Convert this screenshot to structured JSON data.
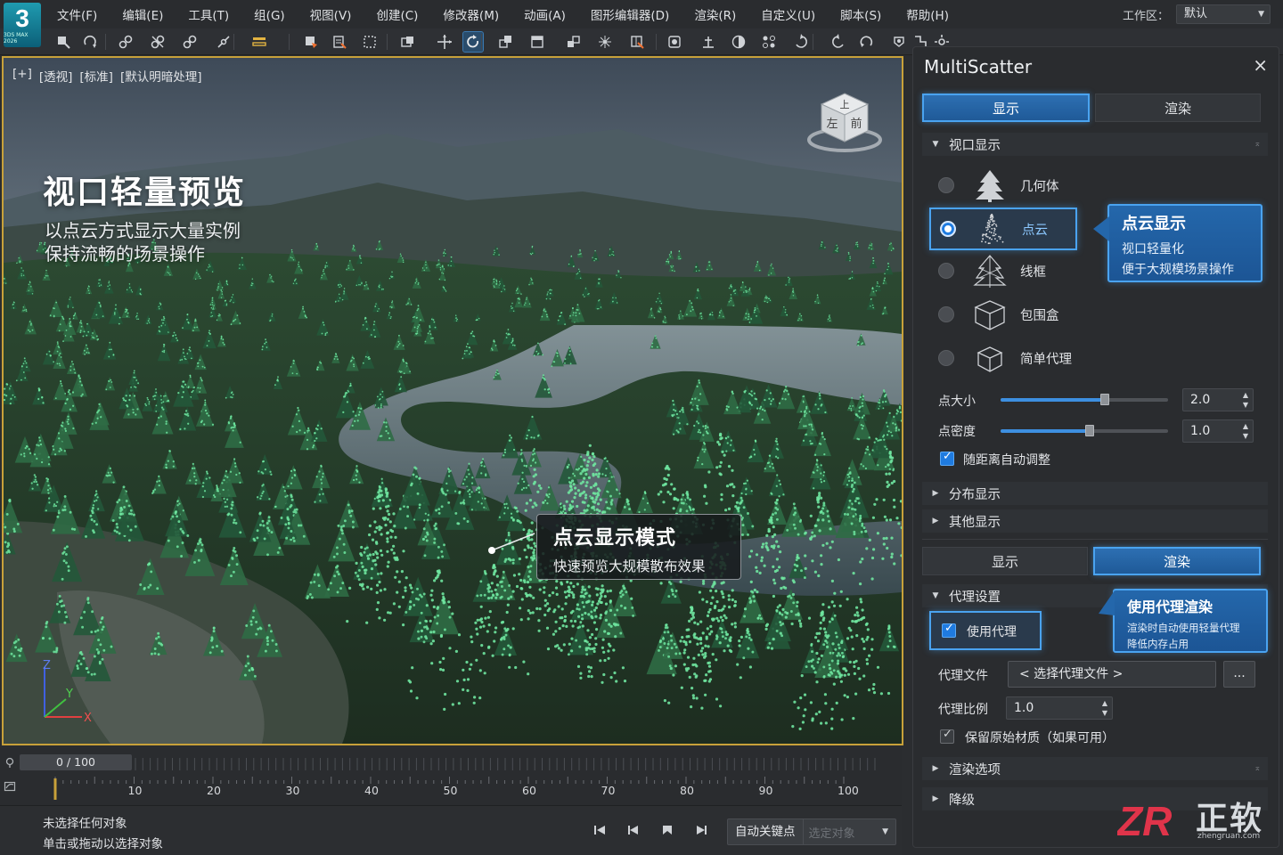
{
  "app": {
    "logo_number": "3",
    "logo_sub": "3DS MAX 2026"
  },
  "menubar": {
    "items": [
      "文件(F)",
      "编辑(E)",
      "工具(T)",
      "组(G)",
      "视图(V)",
      "创建(C)",
      "修改器(M)",
      "动画(A)",
      "图形编辑器(D)",
      "渲染(R)",
      "自定义(U)",
      "脚本(S)",
      "帮助(H)"
    ],
    "workspace_label": "工作区：",
    "workspace_value": "默认"
  },
  "toolbar": {
    "icons": [
      "select-icon",
      "redo-icon",
      "link-icon",
      "unlink-icon",
      "bind-icon",
      "unbind-icon",
      "selection-filter-icon",
      "select-object-icon",
      "select-by-name-icon",
      "rect-region-icon",
      "window-crossing-icon",
      "move-icon",
      "rotate-icon",
      "scale-icon",
      "ref-coord-icon",
      "pivot-icon",
      "snap-icon",
      "mirror-icon",
      "align-icon",
      "layers-icon",
      "scene-explorer-icon",
      "material-icon",
      "render-setup-icon",
      "render-frame-icon",
      "undo-icon",
      "redo2-icon",
      "viewport-icon",
      "settings-icon"
    ],
    "active_icon": "rotate-icon"
  },
  "viewport": {
    "labels": [
      "[+]",
      "[透视]",
      "[标准]",
      "[默认明暗处理]"
    ],
    "title": "视口轻量预览",
    "subtitle_1": "以点云方式显示大量实例",
    "subtitle_2": "保持流畅的场景操作",
    "viewcube": {
      "top": "上",
      "left": "左",
      "front": "前"
    },
    "callout_title": "点云显示模式",
    "callout_sub": "快速预览大规模散布效果",
    "axes": {
      "x": "X",
      "y": "Y",
      "z": "Z"
    },
    "colors": {
      "border": "#c8a13a",
      "points": "#6fe6a0"
    }
  },
  "timeline": {
    "frame_display": "0 / 100",
    "ruler_labels": [
      "10",
      "20",
      "30",
      "40",
      "50",
      "60",
      "70",
      "80",
      "90",
      "100"
    ]
  },
  "statusbar": {
    "line1": "未选择任何对象",
    "line2": "单击或拖动以选择对象",
    "autokey_label": "自动关键点",
    "autokey_value": "选定对象"
  },
  "panel": {
    "title": "MultiScatter",
    "close": "×",
    "tabs_top": [
      "显示",
      "渲染"
    ],
    "tabs_top_active": 0,
    "section_viewport": "视口显示",
    "display_modes": [
      {
        "label": "几何体",
        "icon": "tree-solid-icon",
        "selected": false
      },
      {
        "label": "点云",
        "icon": "tree-points-icon",
        "selected": true
      },
      {
        "label": "线框",
        "icon": "tree-wire-icon",
        "selected": false
      },
      {
        "label": "包围盒",
        "icon": "bounding-box-icon",
        "selected": false
      },
      {
        "label": "简单代理",
        "icon": "simple-proxy-icon",
        "selected": false
      }
    ],
    "callout_points_title": "点云显示",
    "callout_points_line1": "视口轻量化",
    "callout_points_line2": "便于大规模场景操作",
    "point_size_label": "点大小",
    "point_size_value": "2.0",
    "point_size_level": 0.62,
    "point_density_label": "点密度",
    "point_density_value": "1.0",
    "point_density_level": 0.53,
    "auto_adjust_label": "随距离自动调整",
    "auto_adjust_checked": true,
    "section_distribution": "分布显示",
    "section_other": "其他显示",
    "tabs_bottom": [
      "显示",
      "渲染"
    ],
    "tabs_bottom_active": 1,
    "section_proxy": "代理设置",
    "use_proxy_label": "使用代理",
    "use_proxy_checked": true,
    "callout_proxy_title": "使用代理渲染",
    "callout_proxy_line1": "渲染时自动使用轻量代理",
    "callout_proxy_line2": "降低内存占用",
    "proxy_file_label": "代理文件",
    "proxy_file_value": "< 选择代理文件 >",
    "proxy_browse": "...",
    "proxy_scale_label": "代理比例",
    "proxy_scale_value": "1.0",
    "keep_material_label": "保留原始材质（如果可用）",
    "keep_material_checked": true,
    "section_render_options": "渲染选项",
    "section_degrade": "降级"
  },
  "watermark": {
    "mark": "ZR",
    "name": "正软",
    "url": "zhengruan.com"
  },
  "colors": {
    "accent": "#4aa3f0",
    "tab_active": "#2467ab",
    "watermark_red": "#e0344a"
  }
}
